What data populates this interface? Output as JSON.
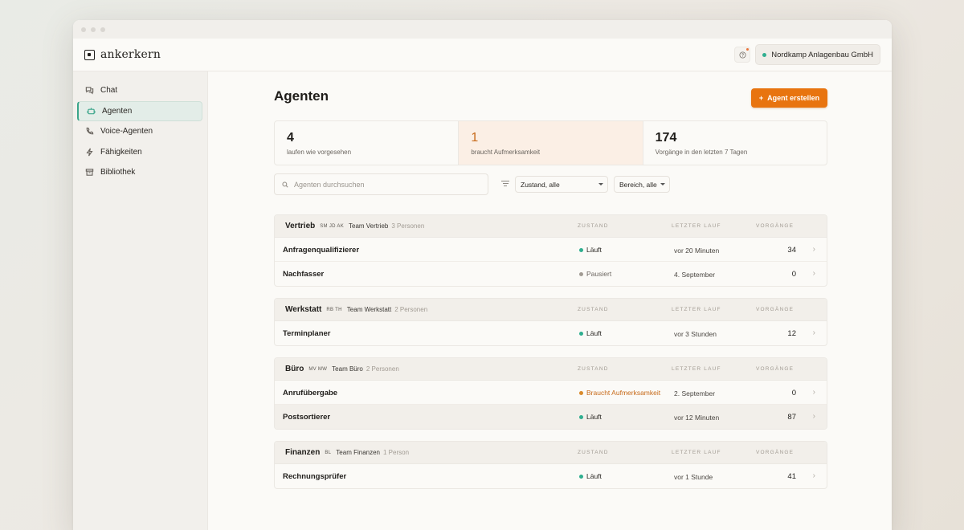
{
  "app": {
    "name": "ankerkern"
  },
  "header": {
    "org_name": "Nordkamp Anlagenbau GmbH",
    "help_icon": "question-circle-icon"
  },
  "sidebar": {
    "items": [
      {
        "label": "Chat",
        "icon": "chat-icon",
        "active": false
      },
      {
        "label": "Agenten",
        "icon": "robot-icon",
        "active": true
      },
      {
        "label": "Voice-Agenten",
        "icon": "phone-icon",
        "active": false
      },
      {
        "label": "Fähigkeiten",
        "icon": "lightning-icon",
        "active": false
      },
      {
        "label": "Bibliothek",
        "icon": "archive-icon",
        "active": false
      }
    ]
  },
  "page": {
    "title": "Agenten",
    "create_button": "Agent erstellen",
    "create_plus": "+"
  },
  "stats": [
    {
      "value": "4",
      "label": "laufen wie vorgesehen"
    },
    {
      "value": "1",
      "label": "braucht Aufmerksamkeit"
    },
    {
      "value": "174",
      "label": "Vorgänge in den letzten 7 Tagen"
    }
  ],
  "filters": {
    "search_placeholder": "Agenten durchsuchen",
    "state_select": "Zustand, alle",
    "area_select": "Bereich, alle"
  },
  "columns": {
    "state": "ZUSTAND",
    "last_run": "LETZTER LAUF",
    "count": "VORGÄNGE"
  },
  "status_colors": {
    "running": "#2fae8f",
    "paused": "#a19b93",
    "attention": "#d98a2b"
  },
  "groups": [
    {
      "name": "Vertrieb",
      "initials": "SM JD AK",
      "team": "Team Vertrieb",
      "members": "3 Personen",
      "rows": [
        {
          "name": "Anfragenqualifizierer",
          "state": "Läuft",
          "state_kind": "running",
          "last_run": "vor 20 Minuten",
          "count": "34"
        },
        {
          "name": "Nachfasser",
          "state": "Pausiert",
          "state_kind": "paused",
          "last_run": "4. September",
          "count": "0"
        }
      ]
    },
    {
      "name": "Werkstatt",
      "initials": "RB TH",
      "team": "Team Werkstatt",
      "members": "2 Personen",
      "rows": [
        {
          "name": "Terminplaner",
          "state": "Läuft",
          "state_kind": "running",
          "last_run": "vor 3 Stunden",
          "count": "12"
        }
      ]
    },
    {
      "name": "Büro",
      "initials": "MV MW",
      "team": "Team Büro",
      "members": "2 Personen",
      "rows": [
        {
          "name": "Anrufübergabe",
          "state": "Braucht Aufmerksamkeit",
          "state_kind": "attention",
          "last_run": "2. September",
          "count": "0"
        },
        {
          "name": "Postsortierer",
          "state": "Läuft",
          "state_kind": "running",
          "last_run": "vor 12 Minuten",
          "count": "87"
        }
      ]
    },
    {
      "name": "Finanzen",
      "initials": "BL",
      "team": "Team Finanzen",
      "members": "1 Person",
      "rows": [
        {
          "name": "Rechnungsprüfer",
          "state": "Läuft",
          "state_kind": "running",
          "last_run": "vor 1 Stunde",
          "count": "41"
        }
      ]
    }
  ]
}
